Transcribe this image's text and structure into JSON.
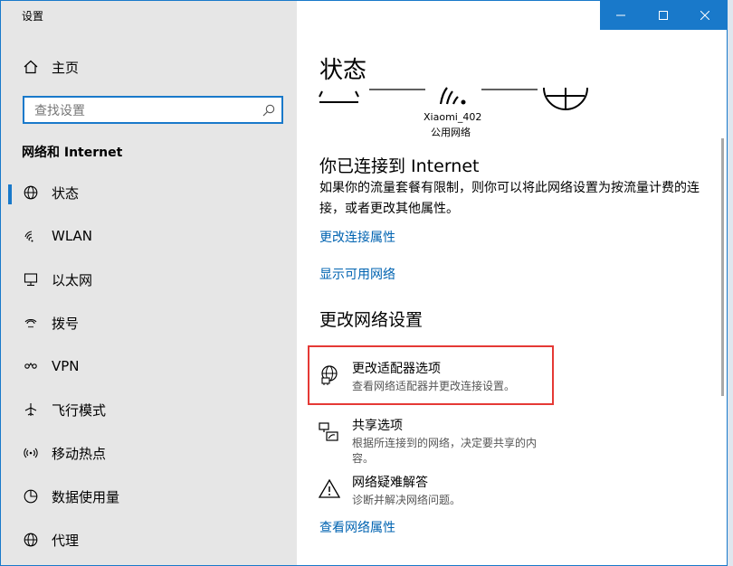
{
  "window": {
    "title": "设置"
  },
  "sidebar": {
    "home_label": "主页",
    "search_placeholder": "查找设置",
    "section_title": "网络和 Internet",
    "items": [
      {
        "label": "状态",
        "icon": "globe-icon"
      },
      {
        "label": "WLAN",
        "icon": "wifi-icon"
      },
      {
        "label": "以太网",
        "icon": "ethernet-icon"
      },
      {
        "label": "拨号",
        "icon": "dialup-icon"
      },
      {
        "label": "VPN",
        "icon": "vpn-icon"
      },
      {
        "label": "飞行模式",
        "icon": "airplane-icon"
      },
      {
        "label": "移动热点",
        "icon": "hotspot-icon"
      },
      {
        "label": "数据使用量",
        "icon": "data-usage-icon"
      },
      {
        "label": "代理",
        "icon": "globe-icon"
      }
    ]
  },
  "main": {
    "title": "状态",
    "network": {
      "name": "Xiaomi_402",
      "type": "公用网络"
    },
    "connected_heading": "你已连接到 Internet",
    "connected_desc": "如果你的流量套餐有限制，则你可以将此网络设置为按流量计费的连接，或者更改其他属性。",
    "link_change_props": "更改连接属性",
    "link_show_networks": "显示可用网络",
    "change_heading": "更改网络设置",
    "options": [
      {
        "title": "更改适配器选项",
        "sub": "查看网络适配器并更改连接设置。"
      },
      {
        "title": "共享选项",
        "sub": "根据所连接到的网络，决定要共享的内容。"
      },
      {
        "title": "网络疑难解答",
        "sub": "诊断并解决网络问题。"
      }
    ],
    "link_view_props": "查看网络属性"
  },
  "colors": {
    "accent": "#1979ca",
    "link": "#0063b1",
    "highlight": "#e53935"
  }
}
